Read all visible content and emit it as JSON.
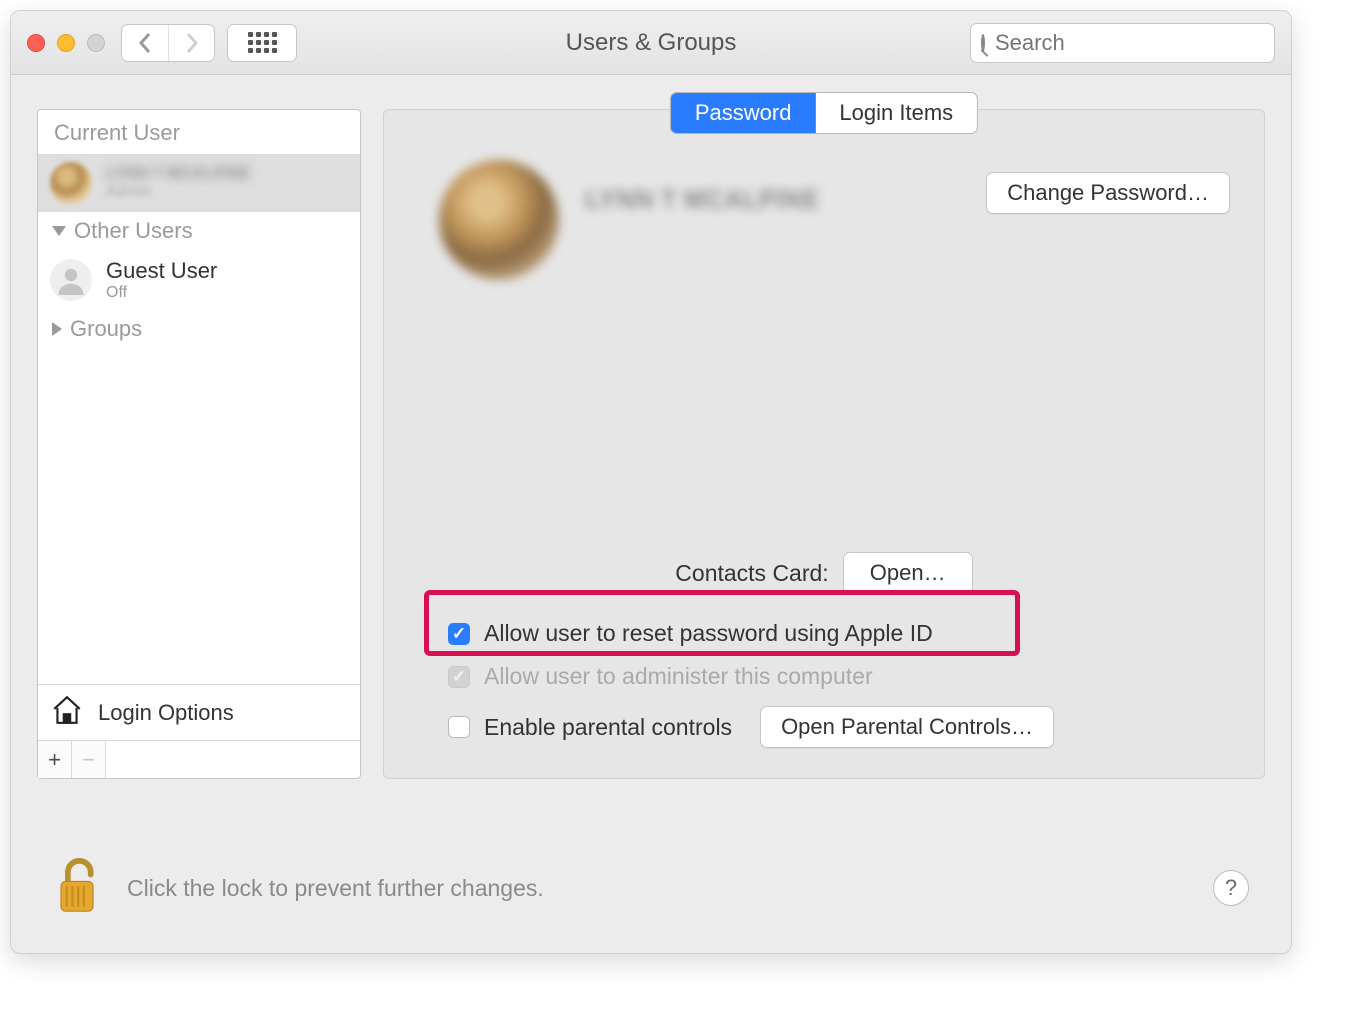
{
  "window": {
    "title": "Users & Groups"
  },
  "search": {
    "placeholder": "Search"
  },
  "sidebar": {
    "header_current": "Current User",
    "current_name": "LYNN T MCALPINE",
    "current_role": "Admin",
    "section_other": "Other Users",
    "guest_name": "Guest User",
    "guest_status": "Off",
    "section_groups": "Groups",
    "login_options": "Login Options"
  },
  "tabs": {
    "password": "Password",
    "login_items": "Login Items"
  },
  "profile": {
    "name": "LYNN T MCALPINE",
    "change_pw": "Change Password…"
  },
  "contacts": {
    "label": "Contacts Card:",
    "open": "Open…"
  },
  "checks": {
    "allow_reset": "Allow user to reset password using Apple ID",
    "allow_admin": "Allow user to administer this computer",
    "parental_label": "Enable parental controls",
    "parental_open": "Open Parental Controls…"
  },
  "footer": {
    "text": "Click the lock to prevent further changes."
  }
}
